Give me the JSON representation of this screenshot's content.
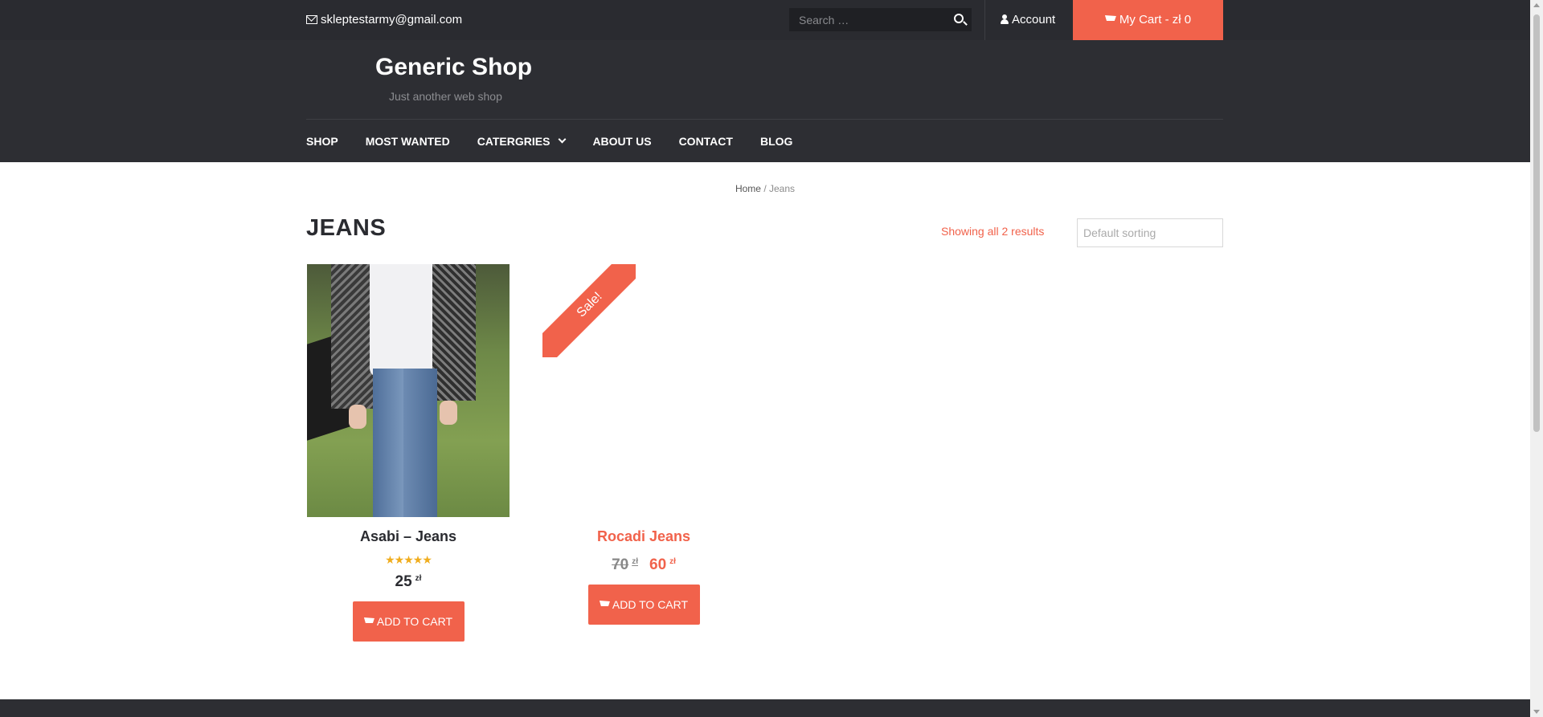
{
  "topbar": {
    "email": "skleptestarmy@gmail.com",
    "search_placeholder": "Search …",
    "account_label": "Account",
    "cart_label": "My Cart - zł 0",
    "accent_color": "#f1624b"
  },
  "header": {
    "site_title": "Generic Shop",
    "tagline": "Just another web shop",
    "nav": [
      "SHOP",
      "MOST WANTED",
      "CATERGRIES",
      "ABOUT US",
      "CONTACT",
      "BLOG"
    ]
  },
  "breadcrumb": {
    "home": "Home",
    "separator": " / ",
    "current": "Jeans"
  },
  "main": {
    "title": "JEANS",
    "result_count": "Showing all 2 results",
    "sort_selected": "Default sorting"
  },
  "products": [
    {
      "name": "Asabi – Jeans",
      "rating": "5 of 5",
      "price": "25",
      "currency": "zł",
      "button": "ADD TO CART"
    },
    {
      "name": "Rocadi Jeans",
      "sale_badge": "Sale!",
      "old_price": "70",
      "price": "60",
      "currency": "zł",
      "button": "ADD TO CART"
    }
  ]
}
